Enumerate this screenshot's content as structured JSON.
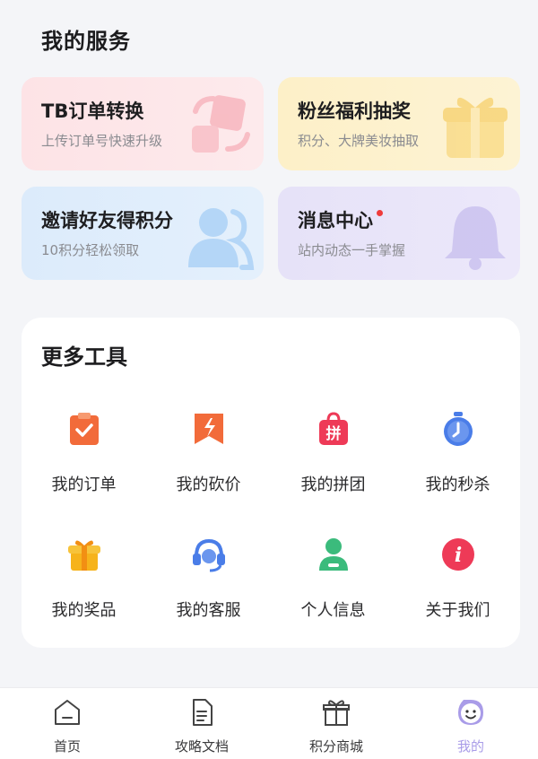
{
  "services": {
    "title": "我的服务",
    "cards": [
      {
        "title": "TB订单转换",
        "subtitle": "上传订单号快速升级",
        "icon": "exchange-icon"
      },
      {
        "title": "粉丝福利抽奖",
        "subtitle": "积分、大牌美妆抽取",
        "icon": "gift-icon"
      },
      {
        "title": "邀请好友得积分",
        "subtitle": "10积分轻松领取",
        "icon": "people-icon"
      },
      {
        "title": "消息中心",
        "subtitle": "站内动态一手掌握",
        "icon": "bell-icon",
        "badge": true
      }
    ]
  },
  "tools": {
    "title": "更多工具",
    "items": [
      {
        "label": "我的订单",
        "icon": "clipboard-check-icon",
        "color": "#f26b3a"
      },
      {
        "label": "我的砍价",
        "icon": "bargain-icon",
        "color": "#f26b3a"
      },
      {
        "label": "我的拼团",
        "icon": "group-buy-bag-icon",
        "glyph": "拼",
        "color": "#ee3a57"
      },
      {
        "label": "我的秒杀",
        "icon": "stopwatch-icon",
        "color": "#4a7de8"
      },
      {
        "label": "我的奖品",
        "icon": "gift-box-icon",
        "color": "#f6b31b"
      },
      {
        "label": "我的客服",
        "icon": "headset-icon",
        "color": "#4a7de8"
      },
      {
        "label": "个人信息",
        "icon": "user-profile-icon",
        "color": "#3bbb7c"
      },
      {
        "label": "关于我们",
        "icon": "info-icon",
        "glyph": "i",
        "color": "#ee3a57"
      }
    ]
  },
  "tabbar": {
    "items": [
      {
        "label": "首页",
        "icon": "home-icon"
      },
      {
        "label": "攻略文档",
        "icon": "document-icon"
      },
      {
        "label": "积分商城",
        "icon": "gift-shop-icon"
      },
      {
        "label": "我的",
        "icon": "smile-face-icon",
        "active": true
      }
    ],
    "active_color": "#a99ce8"
  }
}
